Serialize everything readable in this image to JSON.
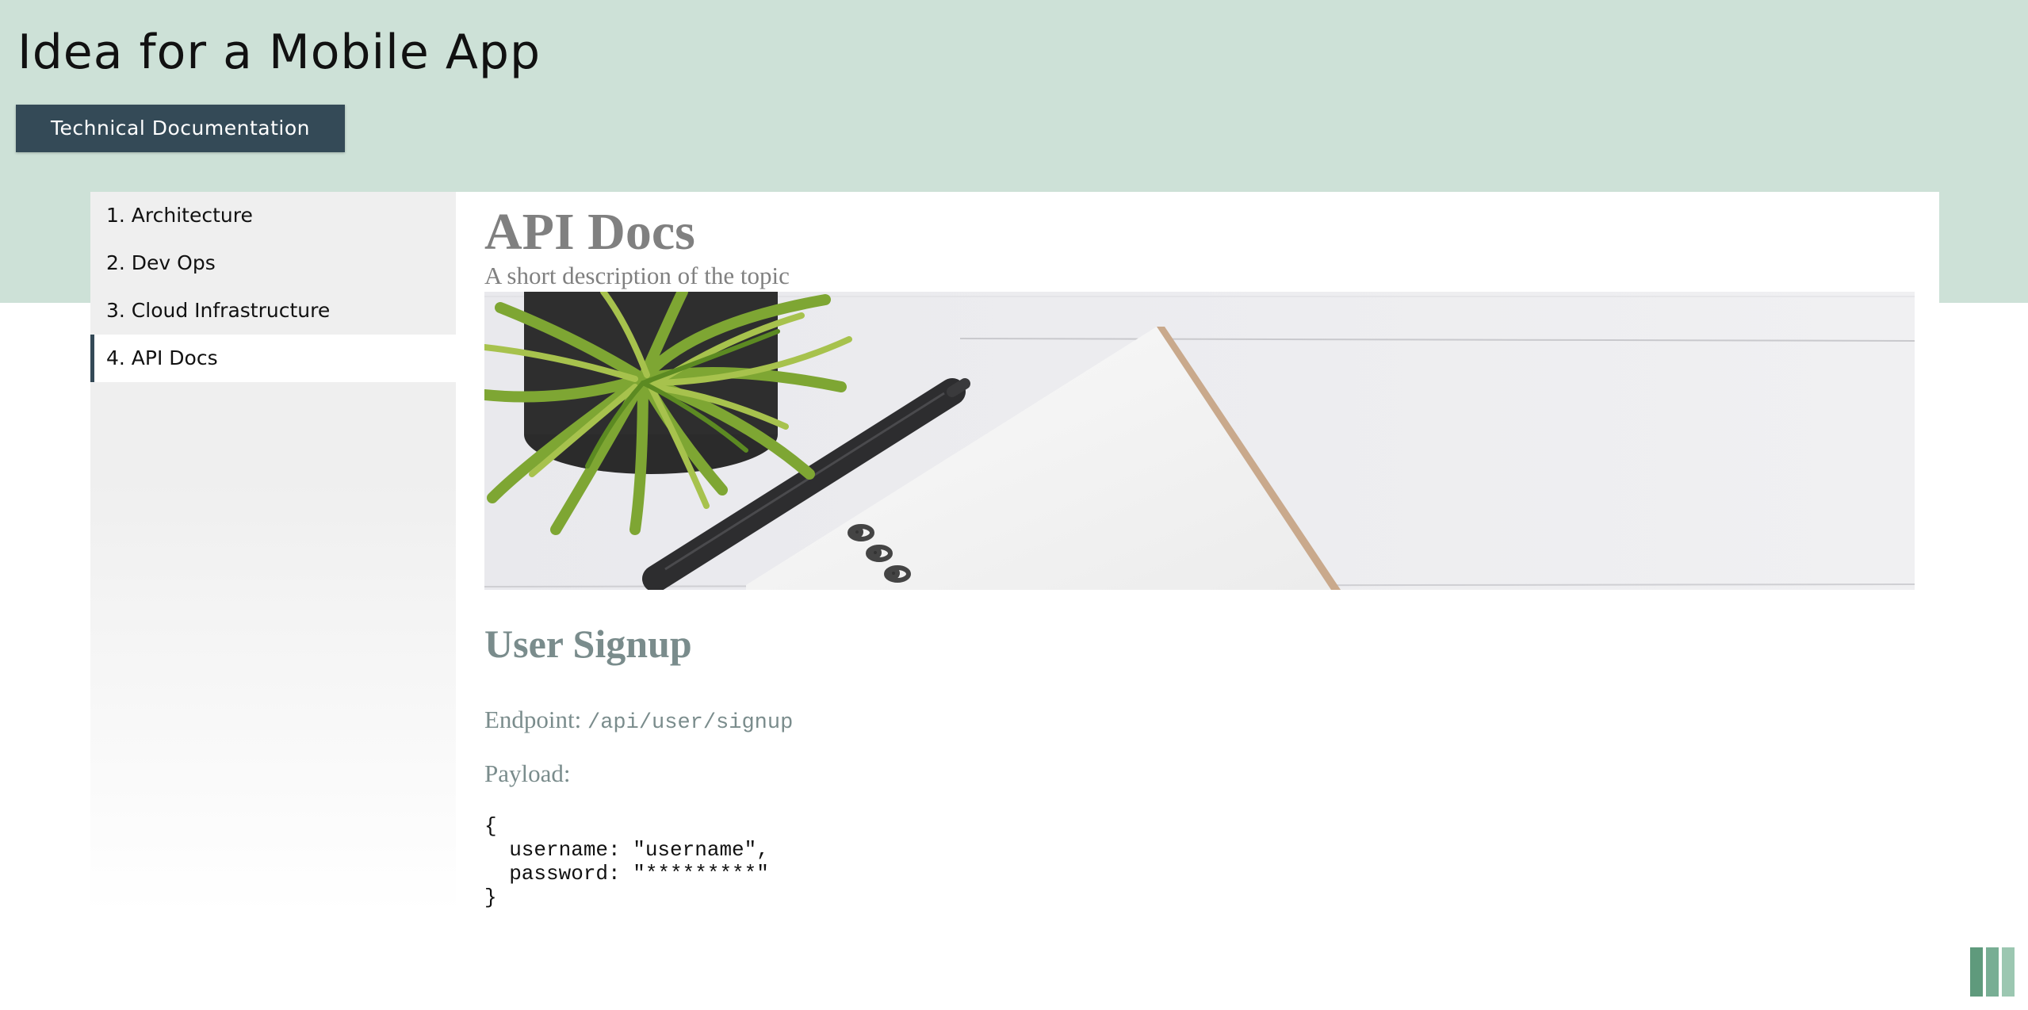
{
  "header": {
    "title": "Idea for a Mobile App",
    "button_label": "Technical Documentation"
  },
  "sidebar": {
    "items": [
      {
        "label": "1. Architecture",
        "active": false
      },
      {
        "label": "2. Dev Ops",
        "active": false
      },
      {
        "label": "3. Cloud Infrastructure",
        "active": false
      },
      {
        "label": "4. API Docs",
        "active": true
      }
    ]
  },
  "main": {
    "heading": "API Docs",
    "description": "A short description of the topic",
    "section": {
      "heading": "User Signup",
      "endpoint_label": "Endpoint:",
      "endpoint_value": "/api/user/signup",
      "payload_label": "Payload:",
      "payload_code": "{\n  username: \"username\",\n  password: \"*********\"\n}"
    }
  },
  "hero_image": {
    "subject": "potted plant, pen and spiral notebook on white wooden desk"
  },
  "colors": {
    "header_band": "#cde1d7",
    "button_bg": "#344a57",
    "sidebar_bg": "#efefef",
    "active_indicator": "#344a57",
    "heading_gray": "#808080",
    "section_gray": "#7a8c8c",
    "logo_green": "#6a9e86"
  }
}
